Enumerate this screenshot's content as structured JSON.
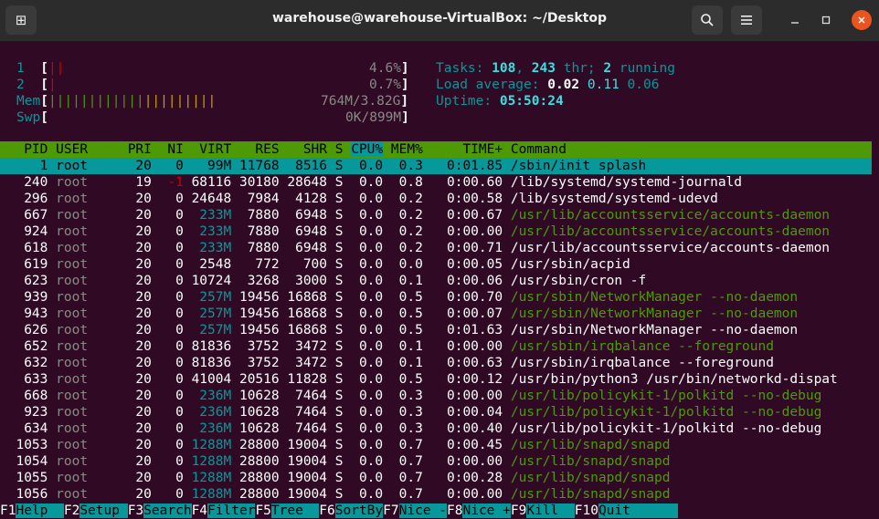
{
  "window": {
    "title": "warehouse@warehouse-VirtualBox: ~/Desktop"
  },
  "meters": {
    "cpu1": {
      "label": "1",
      "bars": "||",
      "value": "4.6%"
    },
    "cpu2": {
      "label": "2",
      "bars": "|",
      "value": "0.7%"
    },
    "mem": {
      "label": "Mem",
      "bars": "|||||||||||||||||||||",
      "value": "764M/3.82G"
    },
    "swp": {
      "label": "Swp",
      "bars": "",
      "value": "0K/899M"
    }
  },
  "summary": {
    "tasks_label": "Tasks: ",
    "tasks": "108",
    "threads": "243",
    "thr_label": " thr; ",
    "running": "2",
    "running_label": " running",
    "load_label": "Load average: ",
    "load1": "0.02",
    "load5": "0.11",
    "load15": "0.06",
    "uptime_label": "Uptime: ",
    "uptime": "05:50:24"
  },
  "table": {
    "columns": [
      "PID",
      "USER",
      "PRI",
      "NI",
      "VIRT",
      "RES",
      "SHR",
      "S",
      "CPU%",
      "MEM%",
      "TIME+",
      "Command"
    ],
    "rows": [
      {
        "pid": "1",
        "user": "root",
        "pri": "20",
        "ni": "0",
        "virt": "99M",
        "res": "11768",
        "shr": "8516",
        "s": "S",
        "cpu": "0.0",
        "mem": "0.3",
        "time": "0:01.85",
        "cmd": "/sbin/init splash",
        "thread": false
      },
      {
        "pid": "240",
        "user": "root",
        "pri": "19",
        "ni": "-1",
        "virt": "68116",
        "res": "30180",
        "shr": "28648",
        "s": "S",
        "cpu": "0.0",
        "mem": "0.8",
        "time": "0:00.60",
        "cmd": "/lib/systemd/systemd-journald",
        "thread": false
      },
      {
        "pid": "296",
        "user": "root",
        "pri": "20",
        "ni": "0",
        "virt": "24648",
        "res": "7984",
        "shr": "4128",
        "s": "S",
        "cpu": "0.0",
        "mem": "0.2",
        "time": "0:00.58",
        "cmd": "/lib/systemd/systemd-udevd",
        "thread": false
      },
      {
        "pid": "667",
        "user": "root",
        "pri": "20",
        "ni": "0",
        "virt": "233M",
        "res": "7880",
        "shr": "6948",
        "s": "S",
        "cpu": "0.0",
        "mem": "0.2",
        "time": "0:00.67",
        "cmd": "/usr/lib/accountsservice/accounts-daemon",
        "thread": true
      },
      {
        "pid": "924",
        "user": "root",
        "pri": "20",
        "ni": "0",
        "virt": "233M",
        "res": "7880",
        "shr": "6948",
        "s": "S",
        "cpu": "0.0",
        "mem": "0.2",
        "time": "0:00.00",
        "cmd": "/usr/lib/accountsservice/accounts-daemon",
        "thread": true
      },
      {
        "pid": "618",
        "user": "root",
        "pri": "20",
        "ni": "0",
        "virt": "233M",
        "res": "7880",
        "shr": "6948",
        "s": "S",
        "cpu": "0.0",
        "mem": "0.2",
        "time": "0:00.71",
        "cmd": "/usr/lib/accountsservice/accounts-daemon",
        "thread": false
      },
      {
        "pid": "619",
        "user": "root",
        "pri": "20",
        "ni": "0",
        "virt": "2548",
        "res": "772",
        "shr": "700",
        "s": "S",
        "cpu": "0.0",
        "mem": "0.0",
        "time": "0:00.05",
        "cmd": "/usr/sbin/acpid",
        "thread": false
      },
      {
        "pid": "623",
        "user": "root",
        "pri": "20",
        "ni": "0",
        "virt": "10724",
        "res": "3268",
        "shr": "3000",
        "s": "S",
        "cpu": "0.0",
        "mem": "0.1",
        "time": "0:00.06",
        "cmd": "/usr/sbin/cron -f",
        "thread": false
      },
      {
        "pid": "939",
        "user": "root",
        "pri": "20",
        "ni": "0",
        "virt": "257M",
        "res": "19456",
        "shr": "16868",
        "s": "S",
        "cpu": "0.0",
        "mem": "0.5",
        "time": "0:00.70",
        "cmd": "/usr/sbin/NetworkManager --no-daemon",
        "thread": true
      },
      {
        "pid": "943",
        "user": "root",
        "pri": "20",
        "ni": "0",
        "virt": "257M",
        "res": "19456",
        "shr": "16868",
        "s": "S",
        "cpu": "0.0",
        "mem": "0.5",
        "time": "0:00.07",
        "cmd": "/usr/sbin/NetworkManager --no-daemon",
        "thread": true
      },
      {
        "pid": "626",
        "user": "root",
        "pri": "20",
        "ni": "0",
        "virt": "257M",
        "res": "19456",
        "shr": "16868",
        "s": "S",
        "cpu": "0.0",
        "mem": "0.5",
        "time": "0:01.63",
        "cmd": "/usr/sbin/NetworkManager --no-daemon",
        "thread": false
      },
      {
        "pid": "652",
        "user": "root",
        "pri": "20",
        "ni": "0",
        "virt": "81836",
        "res": "3752",
        "shr": "3472",
        "s": "S",
        "cpu": "0.0",
        "mem": "0.1",
        "time": "0:00.00",
        "cmd": "/usr/sbin/irqbalance --foreground",
        "thread": true
      },
      {
        "pid": "632",
        "user": "root",
        "pri": "20",
        "ni": "0",
        "virt": "81836",
        "res": "3752",
        "shr": "3472",
        "s": "S",
        "cpu": "0.0",
        "mem": "0.1",
        "time": "0:00.63",
        "cmd": "/usr/sbin/irqbalance --foreground",
        "thread": false
      },
      {
        "pid": "633",
        "user": "root",
        "pri": "20",
        "ni": "0",
        "virt": "41004",
        "res": "20516",
        "shr": "11828",
        "s": "S",
        "cpu": "0.0",
        "mem": "0.5",
        "time": "0:00.12",
        "cmd": "/usr/bin/python3 /usr/bin/networkd-dispat",
        "thread": false
      },
      {
        "pid": "668",
        "user": "root",
        "pri": "20",
        "ni": "0",
        "virt": "236M",
        "res": "10628",
        "shr": "7464",
        "s": "S",
        "cpu": "0.0",
        "mem": "0.3",
        "time": "0:00.00",
        "cmd": "/usr/lib/policykit-1/polkitd --no-debug",
        "thread": true
      },
      {
        "pid": "923",
        "user": "root",
        "pri": "20",
        "ni": "0",
        "virt": "236M",
        "res": "10628",
        "shr": "7464",
        "s": "S",
        "cpu": "0.0",
        "mem": "0.3",
        "time": "0:00.04",
        "cmd": "/usr/lib/policykit-1/polkitd --no-debug",
        "thread": true
      },
      {
        "pid": "634",
        "user": "root",
        "pri": "20",
        "ni": "0",
        "virt": "236M",
        "res": "10628",
        "shr": "7464",
        "s": "S",
        "cpu": "0.0",
        "mem": "0.3",
        "time": "0:00.40",
        "cmd": "/usr/lib/policykit-1/polkitd --no-debug",
        "thread": false
      },
      {
        "pid": "1053",
        "user": "root",
        "pri": "20",
        "ni": "0",
        "virt": "1288M",
        "res": "28800",
        "shr": "19004",
        "s": "S",
        "cpu": "0.0",
        "mem": "0.7",
        "time": "0:00.45",
        "cmd": "/usr/lib/snapd/snapd",
        "thread": true
      },
      {
        "pid": "1054",
        "user": "root",
        "pri": "20",
        "ni": "0",
        "virt": "1288M",
        "res": "28800",
        "shr": "19004",
        "s": "S",
        "cpu": "0.0",
        "mem": "0.7",
        "time": "0:00.00",
        "cmd": "/usr/lib/snapd/snapd",
        "thread": true
      },
      {
        "pid": "1055",
        "user": "root",
        "pri": "20",
        "ni": "0",
        "virt": "1288M",
        "res": "28800",
        "shr": "19004",
        "s": "S",
        "cpu": "0.0",
        "mem": "0.7",
        "time": "0:00.28",
        "cmd": "/usr/lib/snapd/snapd",
        "thread": true
      },
      {
        "pid": "1056",
        "user": "root",
        "pri": "20",
        "ni": "0",
        "virt": "1288M",
        "res": "28800",
        "shr": "19004",
        "s": "S",
        "cpu": "0.0",
        "mem": "0.7",
        "time": "0:00.00",
        "cmd": "/usr/lib/snapd/snapd",
        "thread": true
      }
    ]
  },
  "footer": [
    {
      "key": "F1",
      "label": "Help  "
    },
    {
      "key": "F2",
      "label": "Setup "
    },
    {
      "key": "F3",
      "label": "Search"
    },
    {
      "key": "F4",
      "label": "Filter"
    },
    {
      "key": "F5",
      "label": "Tree  "
    },
    {
      "key": "F6",
      "label": "SortBy"
    },
    {
      "key": "F7",
      "label": "Nice -"
    },
    {
      "key": "F8",
      "label": "Nice +"
    },
    {
      "key": "F9",
      "label": "Kill  "
    },
    {
      "key": "F10",
      "label": "Quit      "
    }
  ],
  "colors": {
    "terminal_bg": "#300a24",
    "header_bg": "#4e9a06",
    "highlight": "#06989a",
    "thread_fg": "#4e9a06"
  },
  "icons": {
    "new_tab": "new-tab-icon",
    "search": "search-icon",
    "menu": "hamburger-menu-icon",
    "minimize": "minimize-icon",
    "maximize": "maximize-icon",
    "close": "close-icon"
  }
}
